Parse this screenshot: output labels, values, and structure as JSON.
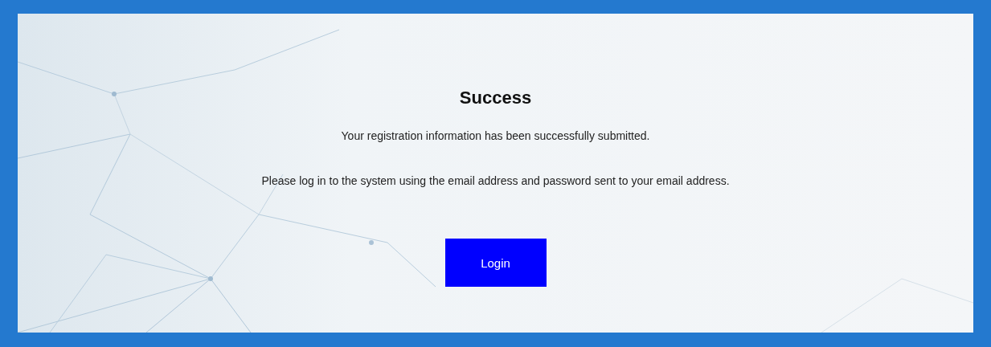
{
  "title": "Success",
  "messages": [
    "Your registration information has been successfully submitted.",
    "Please log in to the system using the email address and password sent to your email address."
  ],
  "login_button": {
    "label": "Login"
  }
}
